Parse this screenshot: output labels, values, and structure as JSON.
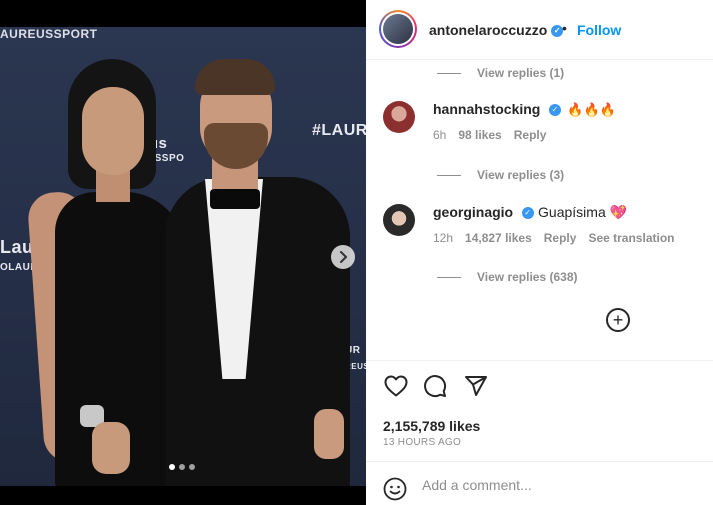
{
  "photo": {
    "backdrop_texts": [
      "AUREUSSPORT",
      "#LAUR",
      "Lau",
      "OLAUR",
      "aus",
      "REUSSPO",
      "UR",
      "REUS"
    ],
    "carousel": {
      "count": 3,
      "active_index": 0
    },
    "next_icon": "chevron-right-icon"
  },
  "header": {
    "username": "antonelaroccuzzo",
    "verified_icon": "check-icon",
    "separator": "•",
    "follow_label": "Follow"
  },
  "replies": {
    "reply_1": "View replies (1)",
    "reply_2": "View replies (3)",
    "reply_3": "View replies (638)"
  },
  "comments": [
    {
      "username": "hannahstocking",
      "text": "🔥🔥🔥",
      "time": "6h",
      "likes": "98 likes",
      "reply_label": "Reply",
      "translate_label": ""
    },
    {
      "username": "georginagio",
      "text": "Guapísima 💖",
      "time": "12h",
      "likes": "14,827 likes",
      "reply_label": "Reply",
      "translate_label": "See translation"
    }
  ],
  "load_more_icon": "plus-circle-icon",
  "actions": {
    "like_icon": "heart-icon",
    "comment_icon": "comment-icon",
    "share_icon": "send-icon"
  },
  "post": {
    "likes": "2,155,789 likes",
    "time_ago": "13 HOURS AGO"
  },
  "comment_box": {
    "emoji_icon": "smiley-icon",
    "placeholder": "Add a comment..."
  },
  "colors": {
    "link_blue": "#0095f6",
    "verified_blue": "#3897f0",
    "muted": "#8e8e8e",
    "text": "#262626"
  }
}
